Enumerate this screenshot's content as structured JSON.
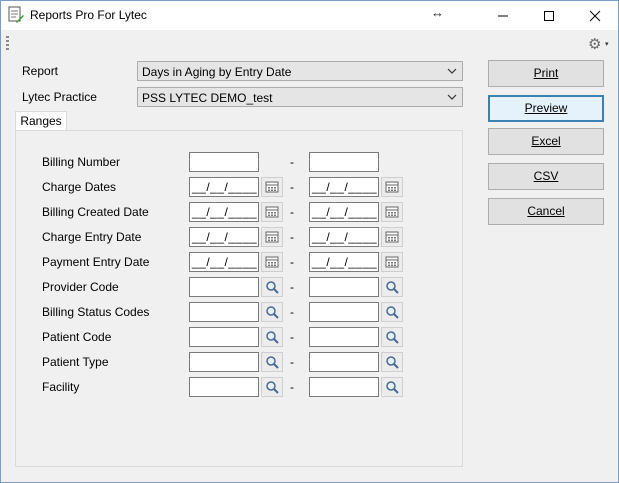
{
  "window": {
    "title": "Reports Pro For Lytec",
    "resize_glyph": "↔"
  },
  "toolbar": {
    "settings_icon": "gear-icon",
    "caret": "▾"
  },
  "report": {
    "label": "Report",
    "value": "Days in Aging by Entry Date"
  },
  "practice": {
    "label": "Lytec Practice",
    "value": "PSS LYTEC DEMO_test"
  },
  "buttons": {
    "print": "Print",
    "preview": "Preview",
    "excel": "Excel",
    "csv": "CSV",
    "cancel": "Cancel"
  },
  "tab": {
    "label": "Ranges"
  },
  "ranges": {
    "separator": "-",
    "date_mask": "__/__/____",
    "rows": [
      {
        "label": "Billing Number",
        "kind": "text"
      },
      {
        "label": "Charge Dates",
        "kind": "date"
      },
      {
        "label": "Billing Created Date",
        "kind": "date"
      },
      {
        "label": "Charge Entry Date",
        "kind": "date"
      },
      {
        "label": "Payment Entry Date",
        "kind": "date"
      },
      {
        "label": "Provider Code",
        "kind": "lookup"
      },
      {
        "label": "Billing Status Codes",
        "kind": "lookup"
      },
      {
        "label": "Patient Code",
        "kind": "lookup"
      },
      {
        "label": "Patient Type",
        "kind": "lookup"
      },
      {
        "label": "Facility",
        "kind": "lookup"
      }
    ]
  }
}
